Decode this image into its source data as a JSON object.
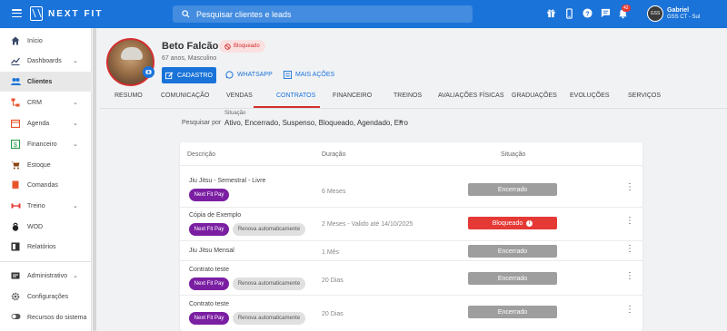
{
  "topbar": {
    "logo": "NEXT FIT",
    "search_placeholder": "Pesquisar clientes e leads",
    "icons": [
      "gift-icon",
      "mobile-icon",
      "help-icon",
      "chat-icon",
      "bell-icon"
    ],
    "notifications": "42",
    "user_name": "Gabriel",
    "user_unit": "GSS CT - Sul",
    "user_initials": "GSS"
  },
  "sidebar": {
    "items": [
      {
        "label": "Início",
        "icon": "home-icon"
      },
      {
        "label": "Dashboards",
        "icon": "chart-icon"
      },
      {
        "label": "Clientes",
        "icon": "people-icon"
      },
      {
        "label": "CRM",
        "icon": "crm-icon"
      },
      {
        "label": "Agenda",
        "icon": "calendar-icon"
      },
      {
        "label": "Financeiro",
        "icon": "money-icon"
      },
      {
        "label": "Estoque",
        "icon": "cart-icon"
      },
      {
        "label": "Comandas",
        "icon": "receipt-icon"
      },
      {
        "label": "Treino",
        "icon": "dumbbell-icon"
      },
      {
        "label": "WOD",
        "icon": "kettlebell-icon"
      },
      {
        "label": "Relatórios",
        "icon": "report-icon"
      },
      {
        "label": "Administrativo",
        "icon": "admin-icon"
      },
      {
        "label": "Configurações",
        "icon": "gear-icon"
      },
      {
        "label": "Recursos do sistema",
        "icon": "toggle-icon"
      }
    ],
    "active": "Clientes"
  },
  "profile": {
    "name": "Beto Falcão",
    "status": "Bloqueado",
    "info": "67 anos, Masculino",
    "btn_cadastro": "CADASTRO",
    "btn_whatsapp": "WHATSAPP",
    "btn_more": "MAIS AÇÕES"
  },
  "tabs": [
    "RESUMO",
    "COMUNICAÇÃO",
    "VENDAS",
    "CONTRATOS",
    "FINANCEIRO",
    "TREINOS",
    "AVALIAÇÕES FÍSICAS",
    "GRADUAÇÕES",
    "EVOLUÇÕES",
    "SERVIÇOS"
  ],
  "active_tab": "CONTRATOS",
  "filter": {
    "label": "Pesquisar por",
    "small": "Situação",
    "value": "Ativo, Encerrado, Suspenso, Bloqueado, Agendado, Erro"
  },
  "table": {
    "headers": {
      "description": "Descrição",
      "duration": "Duração",
      "status": "Situação"
    },
    "rows": [
      {
        "title": "Jiu Jitsu - Semestral - Livre",
        "chips": [
          "Next Fit Pay"
        ],
        "duration": "6 Meses",
        "status": "Encerrado",
        "status_color": "#9e9e9e"
      },
      {
        "title": "Cópia de Exemplo",
        "chips": [
          "Next Fit Pay",
          "Renova automaticamente"
        ],
        "duration": "2 Meses - Valido até 14/10/2025",
        "status": "Bloqueado",
        "status_color": "#e53935"
      },
      {
        "title": "Jiu Jitsu Mensal",
        "chips": [],
        "duration": "1 Mês",
        "status": "Encerrado",
        "status_color": "#9e9e9e"
      },
      {
        "title": "Contrato teste",
        "chips": [
          "Next Fit Pay",
          "Renova automaticamente"
        ],
        "duration": "20 Dias",
        "status": "Encerrado",
        "status_color": "#9e9e9e"
      },
      {
        "title": "Contrato teste",
        "chips": [
          "Next Fit Pay",
          "Renova automaticamente"
        ],
        "duration": "20 Dias",
        "status": "Encerrado",
        "status_color": "#9e9e9e"
      }
    ]
  },
  "colors": {
    "primary": "#1a73d9",
    "danger": "#e53935",
    "pay": "#7b1fa2"
  }
}
